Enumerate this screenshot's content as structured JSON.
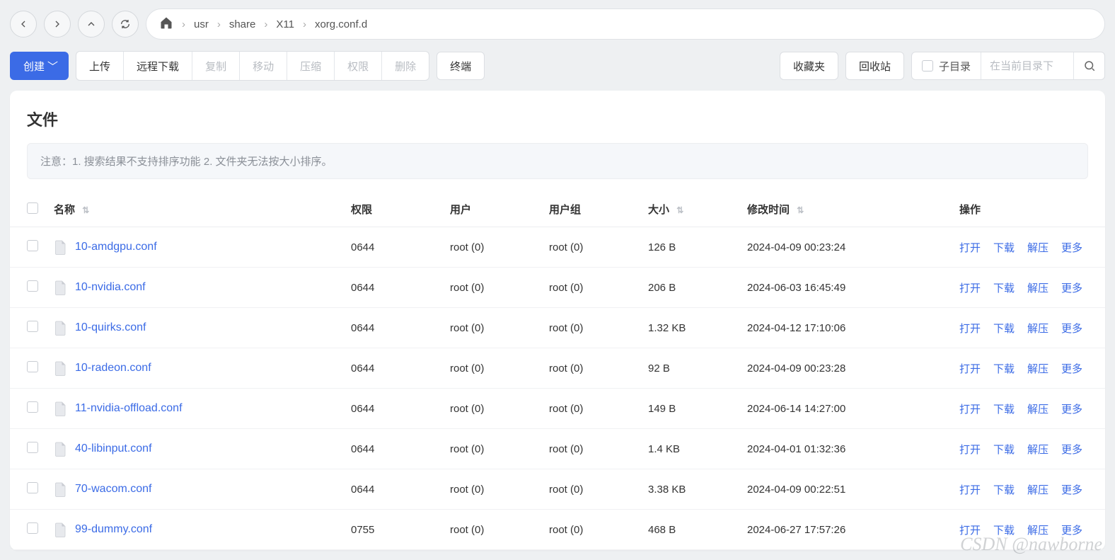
{
  "breadcrumbs": [
    "usr",
    "share",
    "X11",
    "xorg.conf.d"
  ],
  "toolbar": {
    "create": "创建",
    "upload": "上传",
    "remote_download": "远程下载",
    "copy": "复制",
    "move": "移动",
    "compress": "压缩",
    "perm": "权限",
    "delete": "删除",
    "terminal": "终端",
    "favorites": "收藏夹",
    "recycle": "回收站",
    "subdir": "子目录",
    "search_placeholder": "在当前目录下"
  },
  "panel": {
    "title": "文件",
    "notice": "注意：1. 搜索结果不支持排序功能 2. 文件夹无法按大小排序。"
  },
  "columns": {
    "name": "名称",
    "perm": "权限",
    "user": "用户",
    "group": "用户组",
    "size": "大小",
    "mtime": "修改时间",
    "actions": "操作"
  },
  "action_labels": {
    "open": "打开",
    "download": "下载",
    "extract": "解压",
    "more": "更多"
  },
  "files": [
    {
      "name": "10-amdgpu.conf",
      "perm": "0644",
      "user": "root (0)",
      "group": "root (0)",
      "size": "126 B",
      "mtime": "2024-04-09 00:23:24"
    },
    {
      "name": "10-nvidia.conf",
      "perm": "0644",
      "user": "root (0)",
      "group": "root (0)",
      "size": "206 B",
      "mtime": "2024-06-03 16:45:49"
    },
    {
      "name": "10-quirks.conf",
      "perm": "0644",
      "user": "root (0)",
      "group": "root (0)",
      "size": "1.32 KB",
      "mtime": "2024-04-12 17:10:06"
    },
    {
      "name": "10-radeon.conf",
      "perm": "0644",
      "user": "root (0)",
      "group": "root (0)",
      "size": "92 B",
      "mtime": "2024-04-09 00:23:28"
    },
    {
      "name": "11-nvidia-offload.conf",
      "perm": "0644",
      "user": "root (0)",
      "group": "root (0)",
      "size": "149 B",
      "mtime": "2024-06-14 14:27:00"
    },
    {
      "name": "40-libinput.conf",
      "perm": "0644",
      "user": "root (0)",
      "group": "root (0)",
      "size": "1.4 KB",
      "mtime": "2024-04-01 01:32:36"
    },
    {
      "name": "70-wacom.conf",
      "perm": "0644",
      "user": "root (0)",
      "group": "root (0)",
      "size": "3.38 KB",
      "mtime": "2024-04-09 00:22:51"
    },
    {
      "name": "99-dummy.conf",
      "perm": "0755",
      "user": "root (0)",
      "group": "root (0)",
      "size": "468 B",
      "mtime": "2024-06-27 17:57:26"
    }
  ],
  "watermark": "CSDN @nawborne"
}
